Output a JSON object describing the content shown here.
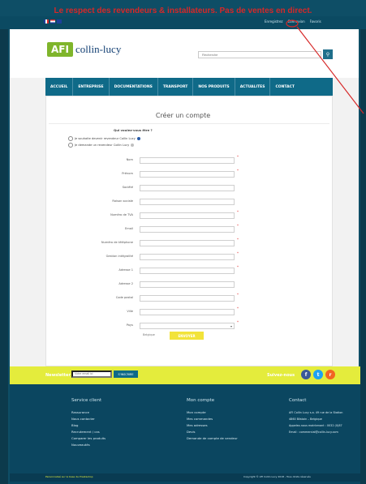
{
  "banner": {
    "text": "Le respect des revendeurs & installateurs. Pas de ventes en direct."
  },
  "top_links": [
    "Enregistrez",
    "Connexion",
    "Favoris"
  ],
  "logo": {
    "mark": "AFI",
    "name": "collin-lucy"
  },
  "search": {
    "placeholder": "Recherche"
  },
  "nav": [
    "ACCUEIL",
    "ENTREPRISE",
    "DOCUMENTATIONS",
    "TRANSPORT",
    "NOS PRODUITS",
    "ACTUALITES",
    "CONTACT"
  ],
  "page": {
    "title": "Créer un compte",
    "question": "Qui voulez-vous être ?"
  },
  "radios": [
    "Je souhaite devenir revendeur Collin Lucy",
    "Je demande un revendeur Collin Lucy"
  ],
  "fields": [
    {
      "label": "Nom",
      "required": true
    },
    {
      "label": "Prénom",
      "required": true
    },
    {
      "label": "Société",
      "required": false
    },
    {
      "label": "Raison sociale",
      "required": false
    },
    {
      "label": "Numéro de TVA",
      "required": true
    },
    {
      "label": "Email",
      "required": true
    },
    {
      "label": "Numéro de téléphone",
      "required": true
    },
    {
      "label": "Gestion intégralité",
      "required": true
    },
    {
      "label": "Adresse 1",
      "required": true
    },
    {
      "label": "Adresse 2",
      "required": false
    },
    {
      "label": "Code postal",
      "required": true
    },
    {
      "label": "Ville",
      "required": true
    },
    {
      "label": "Pays",
      "required": true,
      "type": "select",
      "value": "Belgique"
    }
  ],
  "submit": {
    "label": "ENVOYER"
  },
  "newsletter": {
    "label": "Newsletter",
    "placeholder": "Votre email ici",
    "button": "S'INSCRIRE"
  },
  "social": {
    "label": "Suivez-nous",
    "icons": [
      {
        "name": "facebook-icon",
        "glyph": "f",
        "color": "#3b5998"
      },
      {
        "name": "twitter-icon",
        "glyph": "t",
        "color": "#1da1f2"
      },
      {
        "name": "rss-icon",
        "glyph": "r",
        "color": "#f26522"
      }
    ]
  },
  "footer": {
    "service": {
      "title": "Service client",
      "items": [
        "Rassurance",
        "Nous contacter",
        "Blog",
        "Recrutement / cas",
        "Comparer les produits",
        "Nouveautés"
      ]
    },
    "account": {
      "title": "Mon compte",
      "items": [
        "Mon compte",
        "Mes commandes",
        "Mes adresses",
        "Devis",
        "Demande de compte de vendeur"
      ]
    },
    "contact": {
      "title": "Contact",
      "lines": [
        "AFI Collin Lucy s.a. 49 rue de la Station",
        "4860 Bilstain – Belgique",
        "Appelez-nous maintenant : 0032 (0)87",
        "Email : commercial@collin-lucy.com"
      ]
    }
  },
  "copyright": {
    "left": "Personnalisé sur la base de Prestashop",
    "right": "Copyright © AFI Collin Lucy 2018 - Tous droits réservés"
  },
  "colors": {
    "accent": "#0f6a88",
    "brand_green": "#7fb52b",
    "yellow": "#e4ec3c",
    "banner_red": "#d62828",
    "annotation_red": "#d62828"
  }
}
